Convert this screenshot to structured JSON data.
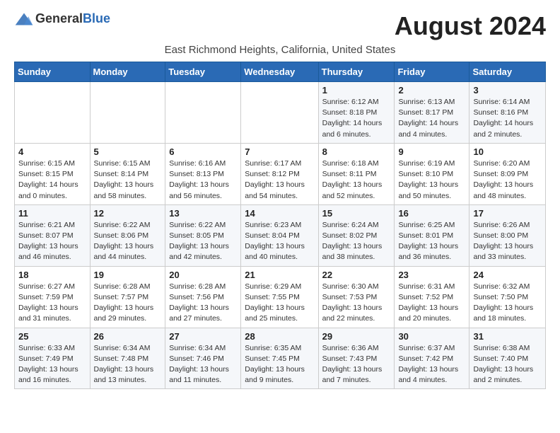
{
  "header": {
    "logo_general": "General",
    "logo_blue": "Blue",
    "month_title": "August 2024",
    "subtitle": "East Richmond Heights, California, United States"
  },
  "weekdays": [
    "Sunday",
    "Monday",
    "Tuesday",
    "Wednesday",
    "Thursday",
    "Friday",
    "Saturday"
  ],
  "weeks": [
    [
      {
        "day": "",
        "info": ""
      },
      {
        "day": "",
        "info": ""
      },
      {
        "day": "",
        "info": ""
      },
      {
        "day": "",
        "info": ""
      },
      {
        "day": "1",
        "info": "Sunrise: 6:12 AM\nSunset: 8:18 PM\nDaylight: 14 hours\nand 6 minutes."
      },
      {
        "day": "2",
        "info": "Sunrise: 6:13 AM\nSunset: 8:17 PM\nDaylight: 14 hours\nand 4 minutes."
      },
      {
        "day": "3",
        "info": "Sunrise: 6:14 AM\nSunset: 8:16 PM\nDaylight: 14 hours\nand 2 minutes."
      }
    ],
    [
      {
        "day": "4",
        "info": "Sunrise: 6:15 AM\nSunset: 8:15 PM\nDaylight: 14 hours\nand 0 minutes."
      },
      {
        "day": "5",
        "info": "Sunrise: 6:15 AM\nSunset: 8:14 PM\nDaylight: 13 hours\nand 58 minutes."
      },
      {
        "day": "6",
        "info": "Sunrise: 6:16 AM\nSunset: 8:13 PM\nDaylight: 13 hours\nand 56 minutes."
      },
      {
        "day": "7",
        "info": "Sunrise: 6:17 AM\nSunset: 8:12 PM\nDaylight: 13 hours\nand 54 minutes."
      },
      {
        "day": "8",
        "info": "Sunrise: 6:18 AM\nSunset: 8:11 PM\nDaylight: 13 hours\nand 52 minutes."
      },
      {
        "day": "9",
        "info": "Sunrise: 6:19 AM\nSunset: 8:10 PM\nDaylight: 13 hours\nand 50 minutes."
      },
      {
        "day": "10",
        "info": "Sunrise: 6:20 AM\nSunset: 8:09 PM\nDaylight: 13 hours\nand 48 minutes."
      }
    ],
    [
      {
        "day": "11",
        "info": "Sunrise: 6:21 AM\nSunset: 8:07 PM\nDaylight: 13 hours\nand 46 minutes."
      },
      {
        "day": "12",
        "info": "Sunrise: 6:22 AM\nSunset: 8:06 PM\nDaylight: 13 hours\nand 44 minutes."
      },
      {
        "day": "13",
        "info": "Sunrise: 6:22 AM\nSunset: 8:05 PM\nDaylight: 13 hours\nand 42 minutes."
      },
      {
        "day": "14",
        "info": "Sunrise: 6:23 AM\nSunset: 8:04 PM\nDaylight: 13 hours\nand 40 minutes."
      },
      {
        "day": "15",
        "info": "Sunrise: 6:24 AM\nSunset: 8:02 PM\nDaylight: 13 hours\nand 38 minutes."
      },
      {
        "day": "16",
        "info": "Sunrise: 6:25 AM\nSunset: 8:01 PM\nDaylight: 13 hours\nand 36 minutes."
      },
      {
        "day": "17",
        "info": "Sunrise: 6:26 AM\nSunset: 8:00 PM\nDaylight: 13 hours\nand 33 minutes."
      }
    ],
    [
      {
        "day": "18",
        "info": "Sunrise: 6:27 AM\nSunset: 7:59 PM\nDaylight: 13 hours\nand 31 minutes."
      },
      {
        "day": "19",
        "info": "Sunrise: 6:28 AM\nSunset: 7:57 PM\nDaylight: 13 hours\nand 29 minutes."
      },
      {
        "day": "20",
        "info": "Sunrise: 6:28 AM\nSunset: 7:56 PM\nDaylight: 13 hours\nand 27 minutes."
      },
      {
        "day": "21",
        "info": "Sunrise: 6:29 AM\nSunset: 7:55 PM\nDaylight: 13 hours\nand 25 minutes."
      },
      {
        "day": "22",
        "info": "Sunrise: 6:30 AM\nSunset: 7:53 PM\nDaylight: 13 hours\nand 22 minutes."
      },
      {
        "day": "23",
        "info": "Sunrise: 6:31 AM\nSunset: 7:52 PM\nDaylight: 13 hours\nand 20 minutes."
      },
      {
        "day": "24",
        "info": "Sunrise: 6:32 AM\nSunset: 7:50 PM\nDaylight: 13 hours\nand 18 minutes."
      }
    ],
    [
      {
        "day": "25",
        "info": "Sunrise: 6:33 AM\nSunset: 7:49 PM\nDaylight: 13 hours\nand 16 minutes."
      },
      {
        "day": "26",
        "info": "Sunrise: 6:34 AM\nSunset: 7:48 PM\nDaylight: 13 hours\nand 13 minutes."
      },
      {
        "day": "27",
        "info": "Sunrise: 6:34 AM\nSunset: 7:46 PM\nDaylight: 13 hours\nand 11 minutes."
      },
      {
        "day": "28",
        "info": "Sunrise: 6:35 AM\nSunset: 7:45 PM\nDaylight: 13 hours\nand 9 minutes."
      },
      {
        "day": "29",
        "info": "Sunrise: 6:36 AM\nSunset: 7:43 PM\nDaylight: 13 hours\nand 7 minutes."
      },
      {
        "day": "30",
        "info": "Sunrise: 6:37 AM\nSunset: 7:42 PM\nDaylight: 13 hours\nand 4 minutes."
      },
      {
        "day": "31",
        "info": "Sunrise: 6:38 AM\nSunset: 7:40 PM\nDaylight: 13 hours\nand 2 minutes."
      }
    ]
  ]
}
